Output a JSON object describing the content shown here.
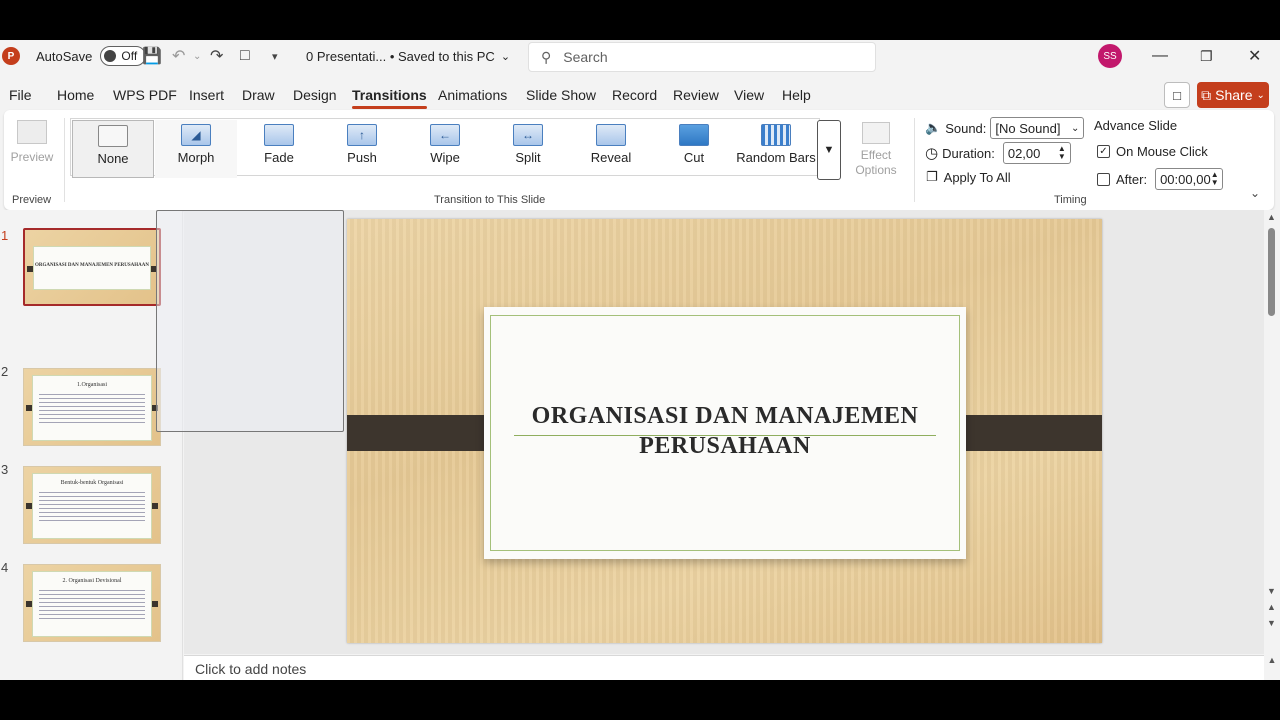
{
  "titlebar": {
    "app_logo": "P",
    "autosave_label": "AutoSave",
    "autosave_state": "Off",
    "doc_title": "0 Presentati... • Saved to this PC",
    "search_placeholder": "Search",
    "user_initials": "SS"
  },
  "menu": {
    "tabs": [
      "File",
      "Home",
      "WPS PDF",
      "Insert",
      "Draw",
      "Design",
      "Transitions",
      "Animations",
      "Slide Show",
      "Record",
      "Review",
      "View",
      "Help"
    ],
    "active": "Transitions",
    "share_label": "Share"
  },
  "ribbon": {
    "preview_label": "Preview",
    "preview_group": "Preview",
    "transitions_group": "Transition to This Slide",
    "transitions": [
      "None",
      "Morph",
      "Fade",
      "Push",
      "Wipe",
      "Split",
      "Reveal",
      "Cut",
      "Random Bars"
    ],
    "selected_transition": "None",
    "effect_options": "Effect Options",
    "sound_label": "Sound:",
    "sound_value": "[No Sound]",
    "duration_label": "Duration:",
    "duration_value": "02,00",
    "apply_all": "Apply To All",
    "advance_slide": "Advance Slide",
    "on_mouse_click": "On Mouse Click",
    "on_mouse_click_checked": true,
    "after_label": "After:",
    "after_value": "00:00,00",
    "after_checked": false,
    "timing_group": "Timing"
  },
  "slides": [
    {
      "number": "1",
      "title": "ORGANISASI DAN MANAJEMEN PERUSAHAAN",
      "active": true
    },
    {
      "number": "2",
      "title": "1.Organisasi"
    },
    {
      "number": "3",
      "title": "Bentuk-bentuk Organisasi"
    },
    {
      "number": "4",
      "title": "2. Organisasi Devisional"
    }
  ],
  "current_slide": {
    "title_line1": "ORGANISASI DAN MANAJEMEN",
    "title_line2": "PERUSAHAAN"
  },
  "notes_placeholder": "Click to add notes",
  "colors": {
    "accent": "#c43e1c",
    "avatar": "#c2186c"
  }
}
